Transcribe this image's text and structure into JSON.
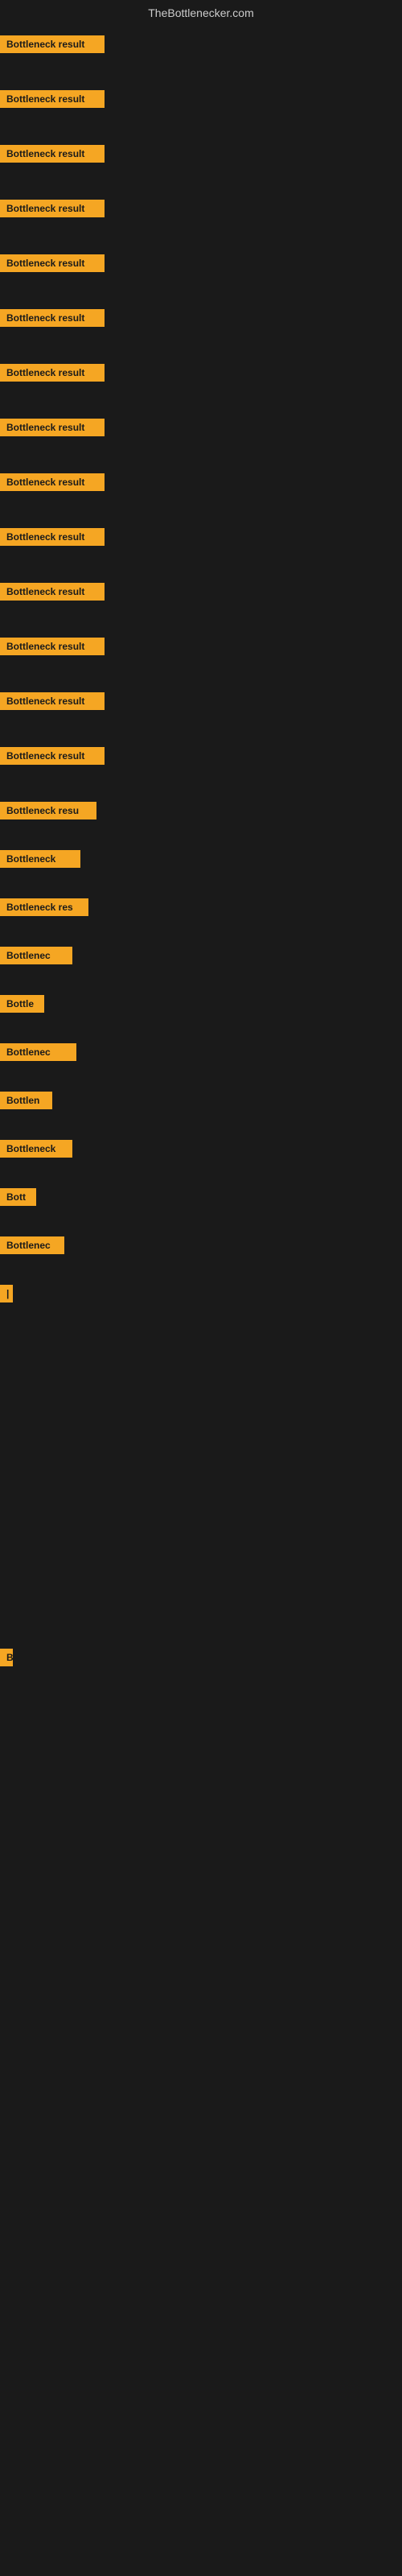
{
  "site": {
    "title": "TheBottlenecker.com"
  },
  "rows": [
    {
      "id": 1,
      "label": "Bottleneck result",
      "class": "row-1"
    },
    {
      "id": 2,
      "label": "Bottleneck result",
      "class": "row-2"
    },
    {
      "id": 3,
      "label": "Bottleneck result",
      "class": "row-3"
    },
    {
      "id": 4,
      "label": "Bottleneck result",
      "class": "row-4"
    },
    {
      "id": 5,
      "label": "Bottleneck result",
      "class": "row-5"
    },
    {
      "id": 6,
      "label": "Bottleneck result",
      "class": "row-6"
    },
    {
      "id": 7,
      "label": "Bottleneck result",
      "class": "row-7"
    },
    {
      "id": 8,
      "label": "Bottleneck result",
      "class": "row-8"
    },
    {
      "id": 9,
      "label": "Bottleneck result",
      "class": "row-9"
    },
    {
      "id": 10,
      "label": "Bottleneck result",
      "class": "row-10"
    },
    {
      "id": 11,
      "label": "Bottleneck result",
      "class": "row-11"
    },
    {
      "id": 12,
      "label": "Bottleneck result",
      "class": "row-12"
    },
    {
      "id": 13,
      "label": "Bottleneck result",
      "class": "row-13"
    },
    {
      "id": 14,
      "label": "Bottleneck result",
      "class": "row-14"
    },
    {
      "id": 15,
      "label": "Bottleneck resu",
      "class": "row-15"
    },
    {
      "id": 16,
      "label": "Bottleneck",
      "class": "row-16"
    },
    {
      "id": 17,
      "label": "Bottleneck res",
      "class": "row-17"
    },
    {
      "id": 18,
      "label": "Bottlenec",
      "class": "row-18"
    },
    {
      "id": 19,
      "label": "Bottle",
      "class": "row-19"
    },
    {
      "id": 20,
      "label": "Bottlenec",
      "class": "row-20"
    },
    {
      "id": 21,
      "label": "Bottlen",
      "class": "row-21"
    },
    {
      "id": 22,
      "label": "Bottleneck",
      "class": "row-22"
    },
    {
      "id": 23,
      "label": "Bott",
      "class": "row-23"
    },
    {
      "id": 24,
      "label": "Bottlenec",
      "class": "row-24"
    },
    {
      "id": 25,
      "label": "|",
      "class": "row-25"
    },
    {
      "id": 26,
      "label": "",
      "class": "row-26"
    },
    {
      "id": 27,
      "label": "",
      "class": "row-27"
    },
    {
      "id": 28,
      "label": "",
      "class": "row-28"
    },
    {
      "id": 29,
      "label": "",
      "class": "row-29"
    },
    {
      "id": 30,
      "label": "B",
      "class": "row-30"
    },
    {
      "id": 31,
      "label": "",
      "class": "row-31"
    },
    {
      "id": 32,
      "label": "",
      "class": "row-32"
    },
    {
      "id": 33,
      "label": "",
      "class": "row-33"
    },
    {
      "id": 34,
      "label": "",
      "class": "row-34"
    },
    {
      "id": 35,
      "label": "",
      "class": "row-35"
    }
  ]
}
